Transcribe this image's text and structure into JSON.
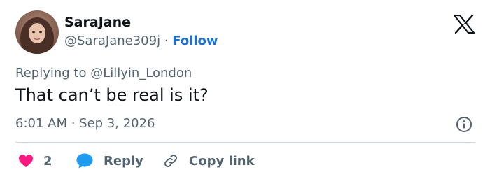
{
  "user": {
    "display_name": "SaraJane",
    "handle": "@SaraJane309j",
    "separator": "·",
    "follow_label": "Follow"
  },
  "tweet": {
    "replying_to": "Replying to @Lillyin_London",
    "text": "That can’t be real is it?",
    "timestamp": "6:01 AM · Sep 3, 2026"
  },
  "actions": {
    "like_count": "2",
    "reply_label": "Reply",
    "copy_link_label": "Copy link"
  },
  "icons": {
    "brand": "x-logo-icon",
    "info": "info-icon",
    "like": "heart-icon",
    "reply": "speech-bubble-icon",
    "copy": "link-icon"
  },
  "colors": {
    "heart": "#f91880",
    "reply_bubble": "#1d9bf0",
    "follow": "#1d6fd0",
    "secondary_text": "#536471"
  }
}
